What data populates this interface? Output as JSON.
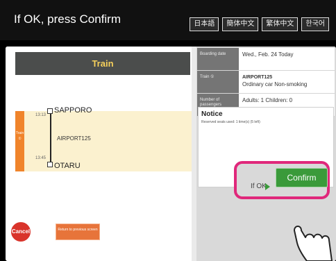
{
  "header": {
    "title": "If OK, press Confirm",
    "languages": [
      "日本語",
      "簡体中文",
      "繁体中文",
      "한국어"
    ]
  },
  "left": {
    "train_header": "Train",
    "route_tab": "Train\n①",
    "stations": [
      {
        "time": "13:13",
        "name": "SAPPORO"
      },
      {
        "time": "13:45",
        "name": "OTARU"
      }
    ],
    "train_name": "AIRPORT125"
  },
  "right": {
    "rows": [
      {
        "label": "Boarding date",
        "value": "Wed., Feb. 24  Today",
        "value2": ""
      },
      {
        "label": "Train ①",
        "value": "AIRPORT125",
        "value2": "Ordinary car   Non-smoking"
      },
      {
        "label": "Number of passengers",
        "value": "Adults: 1  Children: 0",
        "value2": ""
      }
    ],
    "notice": {
      "title": "Notice",
      "text": "Reserved seats used: 1 time(s) (5 left)"
    }
  },
  "footer": {
    "cancel_label": "Cancel",
    "return_label": "Return to previous screen",
    "ifok_label": "If OK",
    "confirm_label": "Confirm"
  },
  "colors": {
    "accent": "#3a9a3a",
    "highlight": "#e0287b",
    "cancel": "#d9342b",
    "return": "#e7743a",
    "header_text": "#f6d05b"
  },
  "icons": [
    "pointing-hand-icon",
    "arrow-right-icon"
  ]
}
